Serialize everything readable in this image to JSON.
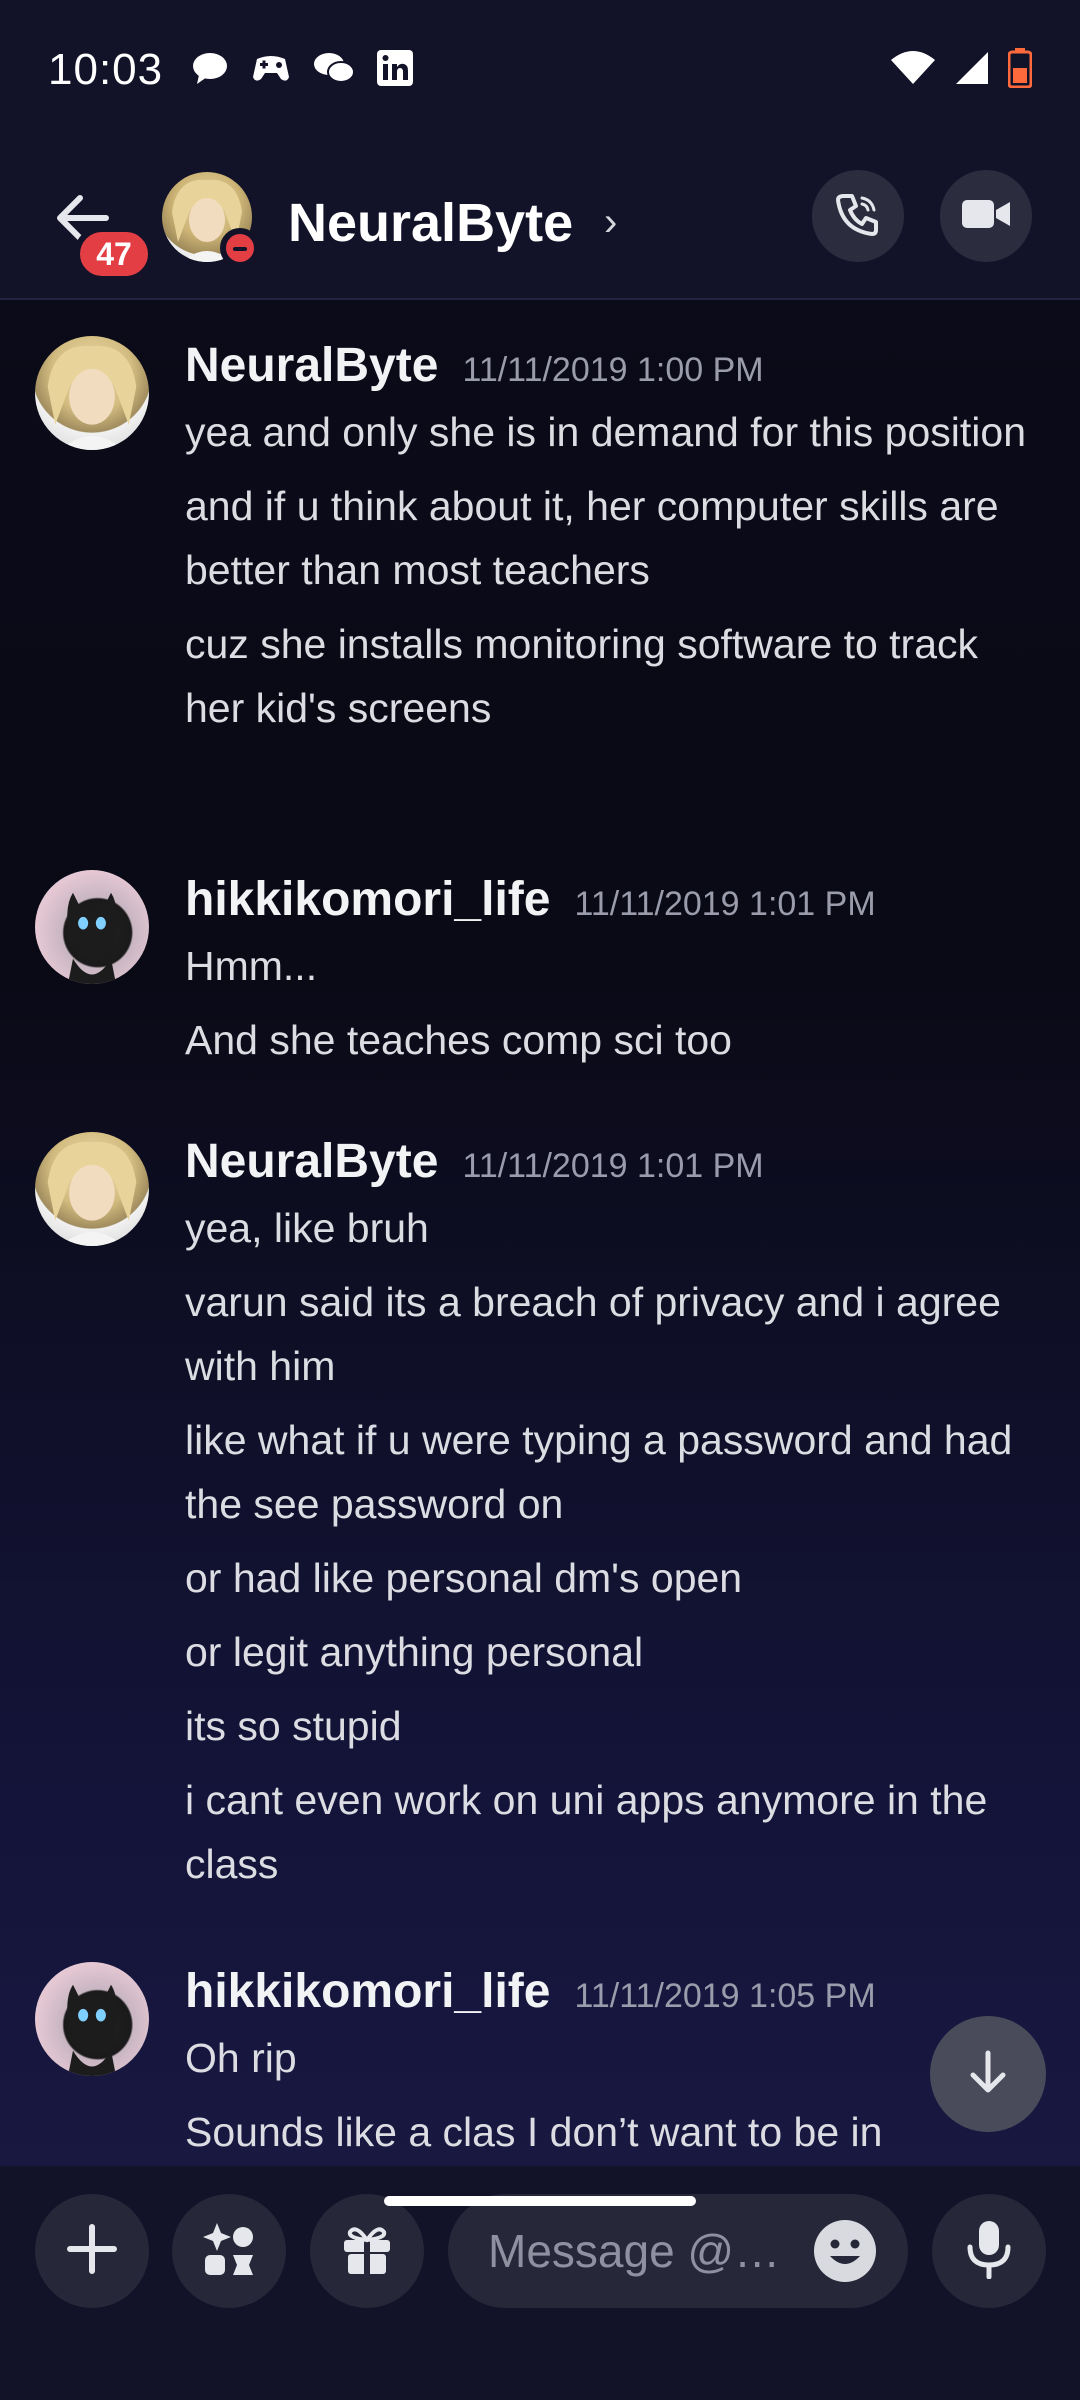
{
  "status_bar": {
    "time": "10:03",
    "app_icons": [
      "chat-bubble-icon",
      "game-controller-icon",
      "wechat-icon",
      "linkedin-icon"
    ],
    "right_icons": [
      "wifi-icon",
      "signal-icon",
      "battery-icon"
    ]
  },
  "header": {
    "back_icon": "arrow-left-icon",
    "unread_badge": "47",
    "title": "NeuralByte",
    "status": "do-not-disturb",
    "chevron": "›",
    "actions": [
      "phone-icon",
      "video-camera-icon"
    ]
  },
  "messages": [
    {
      "username": "NeuralByte",
      "timestamp": "11/11/2019 1:00 PM",
      "lines": [
        "yea and only she is in demand for this position",
        "and if u think about it, her computer skills are better than most teachers",
        "cuz she installs monitoring software to track her kid's screens"
      ]
    },
    {
      "username": "hikkikomori_life",
      "timestamp": "11/11/2019 1:01 PM",
      "lines": [
        "Hmm...",
        "And she teaches comp sci too"
      ]
    },
    {
      "username": "NeuralByte",
      "timestamp": "11/11/2019 1:01 PM",
      "lines": [
        "yea, like bruh",
        "varun said its a breach of privacy and i agree with him",
        "like what if u were typing a password and had the see password on",
        "or had like personal dm's open",
        "or legit anything personal",
        "its so stupid",
        "i cant even work on uni apps anymore in the class"
      ]
    },
    {
      "username": "hikkikomori_life",
      "timestamp": "11/11/2019 1:05 PM",
      "lines": [
        "Oh rip",
        "Sounds like a clas I don’t want to be in"
      ]
    }
  ],
  "composer": {
    "placeholder": "Message @…",
    "buttons": [
      "plus-icon",
      "apps-icon",
      "gift-icon",
      "emoji-icon",
      "microphone-icon"
    ]
  },
  "colors": {
    "badge": "#e23e44",
    "background": "#0b0b1a",
    "bar": "#121228"
  }
}
